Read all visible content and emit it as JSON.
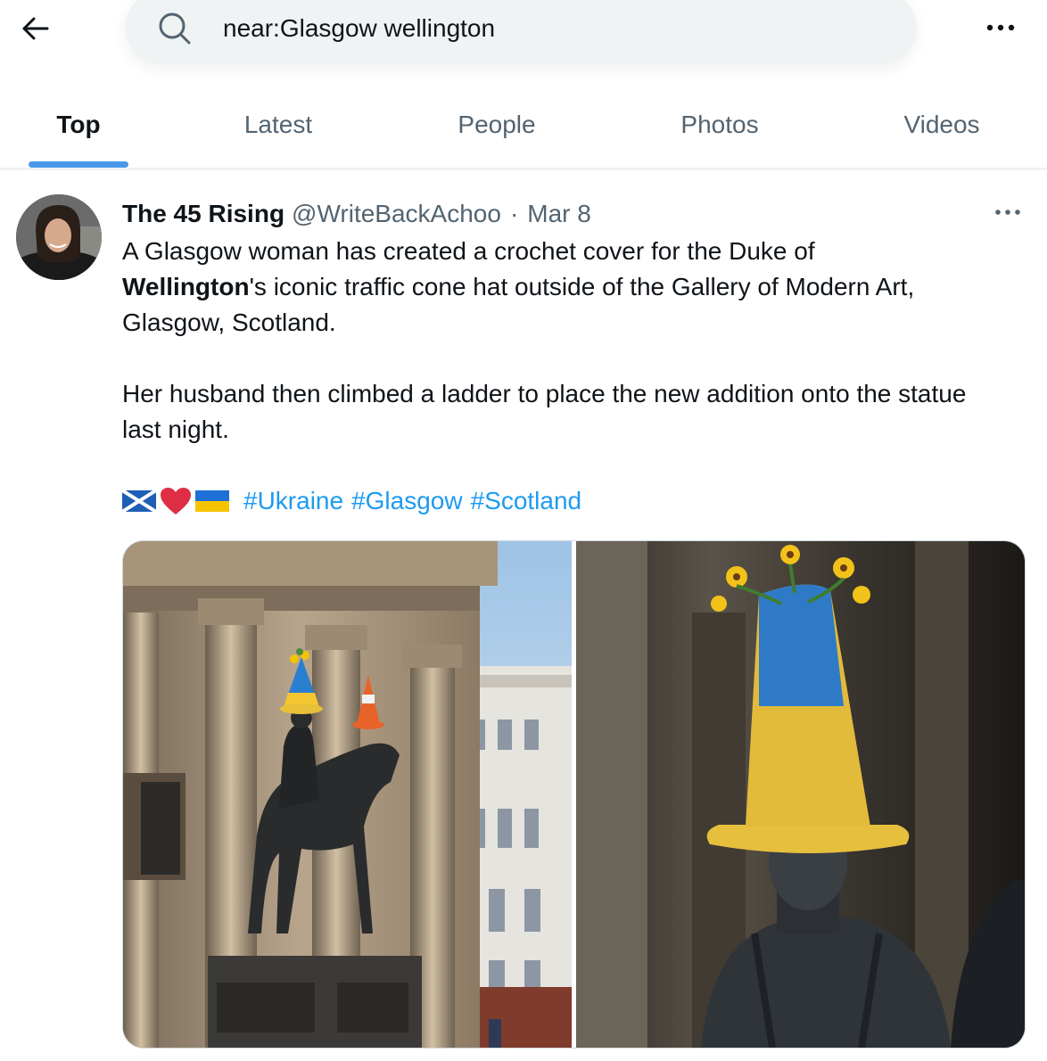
{
  "search": {
    "value": "near:Glasgow wellington"
  },
  "tabs": [
    {
      "label": "Top",
      "active": true
    },
    {
      "label": "Latest"
    },
    {
      "label": "People"
    },
    {
      "label": "Photos"
    },
    {
      "label": "Videos"
    }
  ],
  "tweet": {
    "name": "The 45 Rising",
    "handle": "@WriteBackAchoo",
    "separator": "·",
    "date": "Mar 8",
    "line1": "A Glasgow woman has created a crochet cover for the Duke of",
    "bold_word": "Wellington",
    "line2_rest": "'s iconic traffic cone hat outside of the Gallery of Modern Art,",
    "line3": "Glasgow, Scotland.",
    "para2": "Her husband then climbed a ladder to place the new addition onto the statue last night.",
    "hashtags": [
      "#Ukraine",
      "#Glasgow",
      "#Scotland"
    ],
    "emojis": [
      "scotland-flag-icon",
      "red-heart-icon",
      "ukraine-flag-icon"
    ]
  },
  "colors": {
    "accent": "#1d9bf0",
    "tab_underline": "#4a99e9",
    "muted": "#536471"
  },
  "icons": [
    "back-arrow-icon",
    "search-icon",
    "more-icon"
  ]
}
